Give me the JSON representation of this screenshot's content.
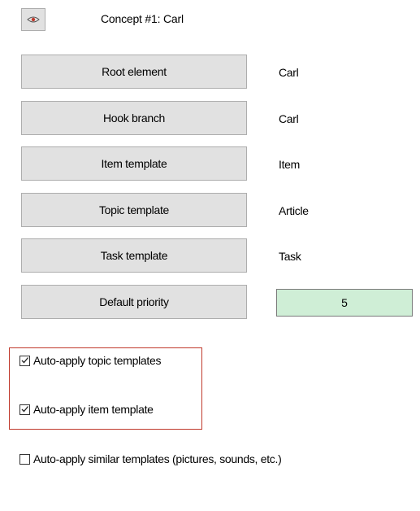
{
  "header": {
    "eye_icon": "eye-icon",
    "concept_label": "Concept #1: Carl"
  },
  "properties": [
    {
      "button_label": "Root element",
      "value": "Carl"
    },
    {
      "button_label": "Hook branch",
      "value": "Carl"
    },
    {
      "button_label": "Item template",
      "value": "Item"
    },
    {
      "button_label": "Topic template",
      "value": "Article"
    },
    {
      "button_label": "Task template",
      "value": "Task"
    }
  ],
  "priority": {
    "button_label": "Default priority",
    "value": "5",
    "field_color": "#cfeed6"
  },
  "options": [
    {
      "label": "Auto-apply topic templates",
      "checked": true
    },
    {
      "label": "Auto-apply item template",
      "checked": true
    },
    {
      "label": "Auto-apply similar templates (pictures, sounds, etc.)",
      "checked": false
    }
  ],
  "colors": {
    "highlight_border": "#c0392b",
    "button_face": "#e1e1e1"
  }
}
